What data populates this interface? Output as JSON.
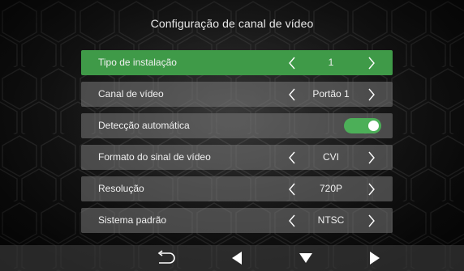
{
  "header": {
    "title": "Configuração de canal de vídeo"
  },
  "rows": [
    {
      "label": "Tipo de instalação",
      "value": "1",
      "selected": true
    },
    {
      "label": "Canal de vídeo",
      "value": "Portão 1"
    },
    {
      "label": "Detecção automática",
      "toggle_on": true
    },
    {
      "label": "Formato do sinal de vídeo",
      "value": "CVI"
    },
    {
      "label": "Resolução",
      "value": "720P"
    },
    {
      "label": "Sistema padrão",
      "value": "NTSC"
    }
  ],
  "colors": {
    "accent_green": "#3f9a48",
    "toggle_green": "#4caf58",
    "row_gray": "#787878",
    "text": "#f0f0f0"
  },
  "bottom_bar": {
    "icons": [
      "back-return-icon",
      "left-triangle-icon",
      "down-triangle-icon",
      "right-triangle-icon"
    ]
  }
}
